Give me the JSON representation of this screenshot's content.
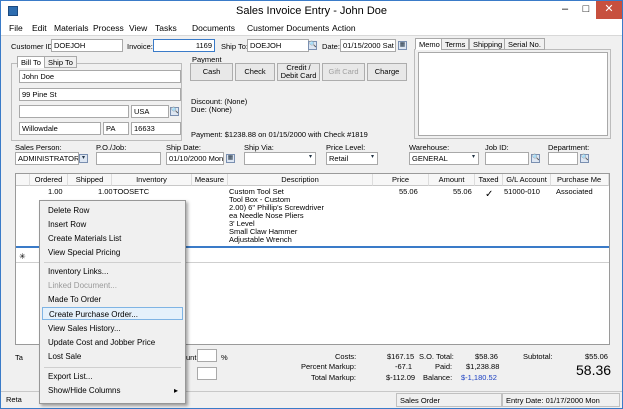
{
  "window": {
    "title": "Sales Invoice Entry - John Doe",
    "minimize": "–",
    "maximize": "□",
    "close": "✕"
  },
  "menu": [
    "File",
    "Edit",
    "Materials",
    "Process",
    "View",
    "Tasks",
    "Documents",
    "Customer Documents",
    "Action"
  ],
  "header": {
    "customer_id_label": "Customer ID:",
    "customer_id": "DOEJOH",
    "invoice_label": "Invoice:",
    "invoice": "1169",
    "ship_to_label": "Ship To:",
    "ship_to": "DOEJOH",
    "date_label": "Date:",
    "date": "01/15/2000 Sat"
  },
  "address": {
    "tab_bill_to": "Bill To",
    "tab_ship_to": "Ship To",
    "name": "John Doe",
    "street": "99 Pine St",
    "line3": "",
    "country": "USA",
    "city": "Willowdale",
    "state": "PA",
    "zip": "16633"
  },
  "payment": {
    "label": "Payment",
    "buttons": [
      "Cash",
      "Check",
      "Credit / Debit Card",
      "Gift Card",
      "Charge"
    ],
    "discount": "Discount: (None)",
    "due": "Due: (None)",
    "summary": "Payment: $1238.88 on 01/15/2000 with Check #1819"
  },
  "memo_tabs": [
    "Memo",
    "Terms",
    "Shipping",
    "Serial No."
  ],
  "details": {
    "sales_person_label": "Sales Person:",
    "sales_person": "ADMINISTRATOR",
    "po_job_label": "P.O./Job:",
    "po_job": "",
    "ship_date_label": "Ship Date:",
    "ship_date": "01/10/2000 Mon",
    "ship_via_label": "Ship Via:",
    "ship_via": "",
    "price_level_label": "Price Level:",
    "price_level": "Retail",
    "warehouse_label": "Warehouse:",
    "warehouse": "GENERAL",
    "job_id_label": "Job ID:",
    "job_id": "",
    "department_label": "Department:",
    "department": ""
  },
  "grid": {
    "columns": [
      "Ordered",
      "Shipped",
      "Inventory",
      "Measure",
      "Description",
      "Price",
      "Amount",
      "Taxed",
      "G/L Account",
      "Purchase Me"
    ],
    "row": {
      "ordered": "1.00",
      "shipped": "1.00",
      "inventory": "TOOSETC",
      "measure": "",
      "description": [
        "Custom Tool Set",
        "Tool Box - Custom",
        "2.00) 6\" Phillip's Screwdriver",
        "ea Needle Nose Pliers",
        "3' Level",
        "Small Claw Hammer",
        "Adjustable Wrench"
      ],
      "price": "55.06",
      "amount": "55.06",
      "taxed": "✓",
      "gl_account": "51000-010",
      "purchase": "Associated"
    }
  },
  "context_menu": {
    "items": [
      "Delete Row",
      "Insert Row",
      "Create Materials List",
      "View Special Pricing",
      "Inventory Links...",
      "Linked Document...",
      "Made To Order",
      "Create Purchase Order...",
      "View Sales History...",
      "Update Cost and Jobber Price",
      "Lost Sale",
      "Export List...",
      "Show/Hide Columns"
    ],
    "submenu_arrow": "▸"
  },
  "totals": {
    "costs_label": "Costs:",
    "costs": "$167.15",
    "so_total_label": "S.O. Total:",
    "so_total": "$58.36",
    "subtotal_label": "Subtotal:",
    "subtotal": "$55.06",
    "percent_markup_label": "Percent Markup:",
    "percent_markup": "-67.1",
    "paid_label": "Paid:",
    "paid": "$1,238.88",
    "total_markup_label": "Total Markup:",
    "total_markup": "$-112.09",
    "balance_label": "Balance:",
    "balance": "$-1,180.52",
    "grand_total": "58.36"
  },
  "left_bottom": {
    "tax_fragment": "Ta",
    "amount_fragment": "unt:",
    "percent": "%"
  },
  "status": {
    "left": "Reta",
    "middle": "Sales Order",
    "right": "Entry Date: 01/17/2000 Mon"
  },
  "colors": {
    "accent": "#3a7bc8",
    "balance": "#1a3fc2",
    "selection": "#e5f1fb"
  }
}
